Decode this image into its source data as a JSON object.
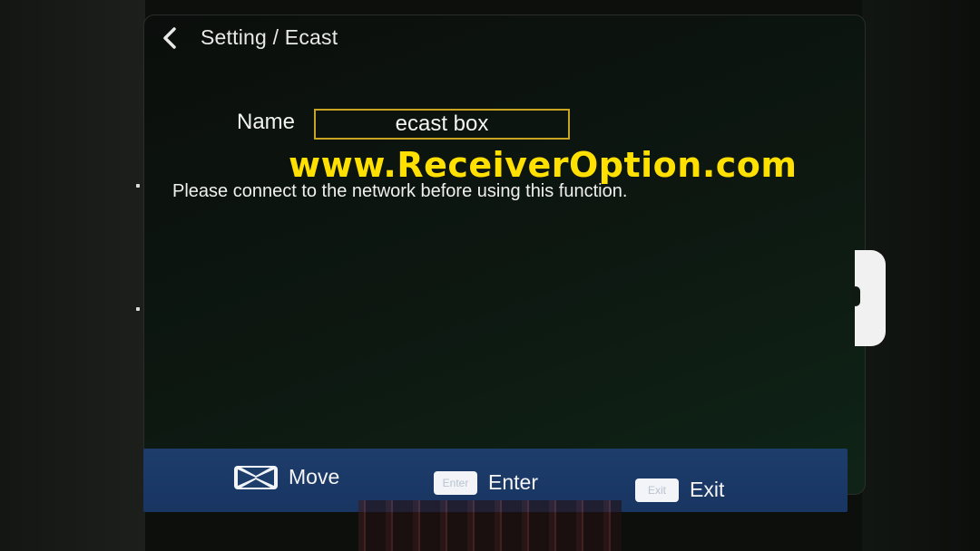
{
  "header": {
    "breadcrumb": "Setting / Ecast",
    "back_icon": "chevron-left-icon"
  },
  "form": {
    "name_label": "Name",
    "name_value": "ecast box"
  },
  "watermark": "www.ReceiverOption.com",
  "message": "Please connect to the network before using this function.",
  "footer": {
    "hints": [
      {
        "key_icon": "arrows-key-icon",
        "key_text": "",
        "label": "Move"
      },
      {
        "key_icon": "enter-key-icon",
        "key_text": "Enter",
        "label": "Enter"
      },
      {
        "key_icon": "exit-key-icon",
        "key_text": "Exit",
        "label": "Exit"
      }
    ]
  },
  "colors": {
    "field_border": "#c9a423",
    "watermark": "#ffe000",
    "footer_bar": "#1d3d6b"
  }
}
